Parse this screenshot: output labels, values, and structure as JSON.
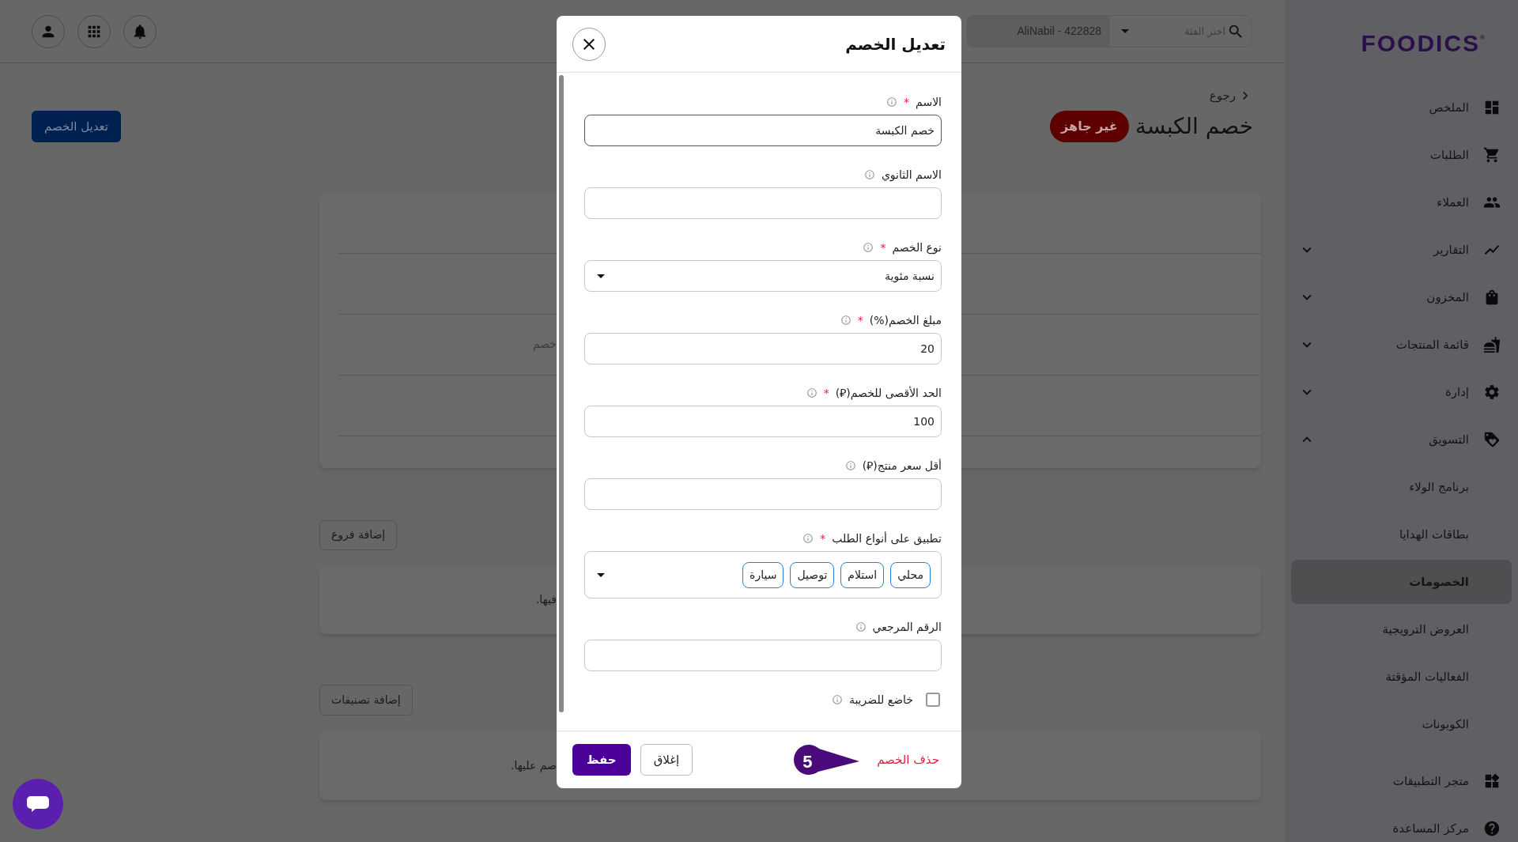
{
  "top_bar": {
    "branch_field": {
      "value": "AliNabil - 422828"
    },
    "category_select": {
      "placeholder": "اختر الفئة"
    }
  },
  "sidebar": {
    "logo": "FOODICS",
    "logo_mark": "®",
    "items": [
      {
        "label": "الملخص",
        "selected": false
      },
      {
        "label": "الطلبات",
        "selected": false
      },
      {
        "label": "العملاء",
        "selected": false
      },
      {
        "label": "التقارير",
        "selected": false,
        "expanded": false
      },
      {
        "label": "المخزون",
        "selected": false,
        "expanded": false
      },
      {
        "label": "قائمة المنتجات",
        "selected": false,
        "expanded": false
      },
      {
        "label": "إدارة",
        "selected": false,
        "expanded": false
      },
      {
        "label": "التسويق",
        "selected": false,
        "expanded": true,
        "children": [
          {
            "label": "برنامج الولاء",
            "selected": false
          },
          {
            "label": "بطاقات الهدايا",
            "selected": false
          },
          {
            "label": "الخصومات",
            "selected": true
          },
          {
            "label": "العروض الترويجية",
            "selected": false
          },
          {
            "label": "الفعاليات المؤقتة",
            "selected": false
          },
          {
            "label": "الكوبونات",
            "selected": false
          }
        ]
      },
      {
        "label": "متجر التطبيقات",
        "selected": false
      },
      {
        "label": "مركز المساعدة",
        "selected": false
      }
    ]
  },
  "page": {
    "back_link": "رجوع",
    "title": "خصم الكبسة",
    "status_badge": "غير جاهز",
    "edit_button": "تعديل الخصم",
    "card_text": "خصم",
    "add_branches_button": "إضافة فروع",
    "branches_text": "فيها.",
    "add_categories_button": "إضافة تصنيفات",
    "categories_text": "صم عليها."
  },
  "modal": {
    "title": "تعديل الخصم",
    "fields": [
      {
        "kind": "text",
        "label": "الاسم",
        "required_mark": "*",
        "value": "خصم الكبسة"
      },
      {
        "kind": "text",
        "label": "الاسم الثانوي"
      },
      {
        "kind": "select",
        "label": "نوع الخصم",
        "required_mark": "*",
        "value": "نسبة مئوية"
      },
      {
        "kind": "text",
        "label": "مبلغ الخصم(%)",
        "required_mark": "*",
        "value": "20"
      },
      {
        "kind": "text",
        "label": "الحد الأقصى للخصم(⃁)",
        "required_mark": "*",
        "value": "100"
      },
      {
        "kind": "text",
        "label": "أقل سعر منتج(⃁)"
      },
      {
        "kind": "chips",
        "label": "تطبيق على أنواع الطلب",
        "required_mark": "*",
        "chips": [
          "محلي",
          "استلام",
          "توصيل",
          "سيارة"
        ]
      },
      {
        "kind": "text",
        "label": "الرقم المرجعي"
      },
      {
        "kind": "checkbox",
        "label": "خاضع للضريبة",
        "checked": false
      }
    ],
    "save_button": "حفظ",
    "close_button": "إغلاق",
    "delete_link": "حذف الخصم",
    "step_marker": "5"
  }
}
